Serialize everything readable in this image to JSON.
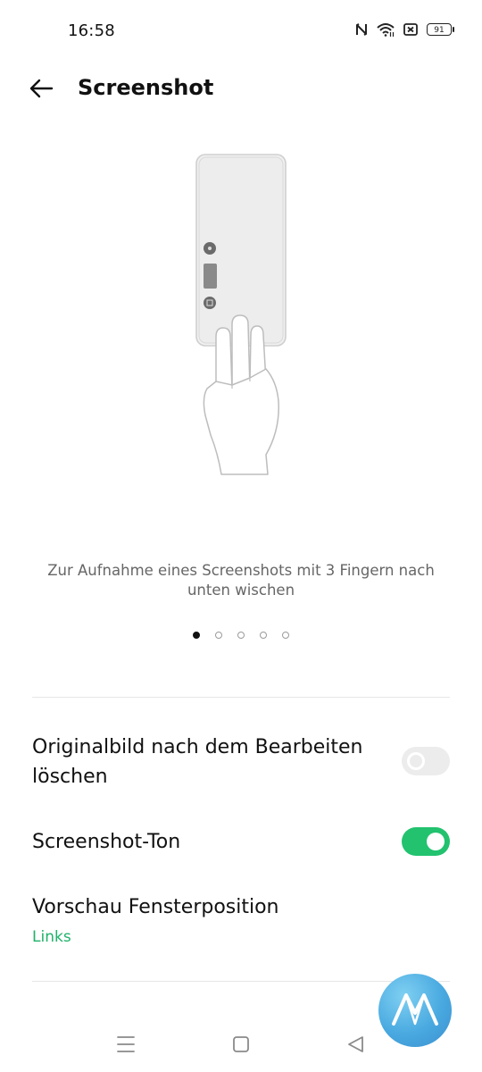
{
  "status_bar": {
    "time": "16:58",
    "battery_level": "91",
    "icons": [
      "nfc-icon",
      "wifi-icon",
      "no-sim-icon",
      "battery-icon"
    ]
  },
  "header": {
    "back_icon": "arrow-left-icon",
    "title": "Screenshot"
  },
  "tutorial": {
    "caption": "Zur Aufnahme eines Screenshots mit 3 Fingern nach unten wischen",
    "page_count": 5,
    "active_page": 1
  },
  "settings": {
    "delete_original": {
      "label": "Originalbild nach dem Bearbeiten löschen",
      "enabled": false
    },
    "screenshot_sound": {
      "label": "Screenshot-Ton",
      "enabled": true
    },
    "preview_position": {
      "label": "Vorschau Fensterposition",
      "value": "Links"
    }
  },
  "nav_bar": {
    "icons": [
      "menu-icon",
      "home-icon",
      "back-triangle-icon"
    ]
  },
  "colors": {
    "accent": "#22c26f",
    "accent_text": "#1fb26a",
    "toggle_off": "#ececec"
  }
}
